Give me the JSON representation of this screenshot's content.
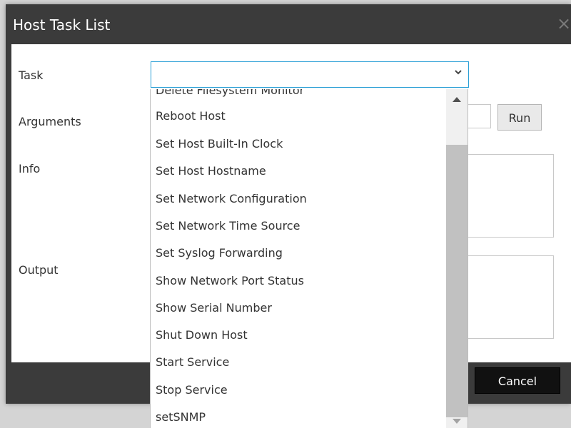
{
  "dialog": {
    "title": "Host Task List",
    "close_glyph": "×"
  },
  "form": {
    "task_label": "Task",
    "arguments_label": "Arguments",
    "info_label": "Info",
    "output_label": "Output",
    "task_selected": "",
    "arguments_value": "",
    "run_label": "Run",
    "cancel_label": "Cancel"
  },
  "dropdown": {
    "partial_top_item": "Delete Filesystem Monitor",
    "options": [
      "Reboot Host",
      "Set Host Built-In Clock",
      "Set Host Hostname",
      "Set Network Configuration",
      "Set Network Time Source",
      "Set Syslog Forwarding",
      "Show Network Port Status",
      "Show Serial Number",
      "Shut Down Host",
      "Start Service",
      "Stop Service",
      "setSNMP"
    ]
  },
  "icons": {
    "select_chevron": "chevron-down-icon",
    "close": "close-icon"
  },
  "colors": {
    "dialog_header": "#3b3b3b",
    "focus_border": "#2a9fd6",
    "cancel_button": "#111111"
  }
}
